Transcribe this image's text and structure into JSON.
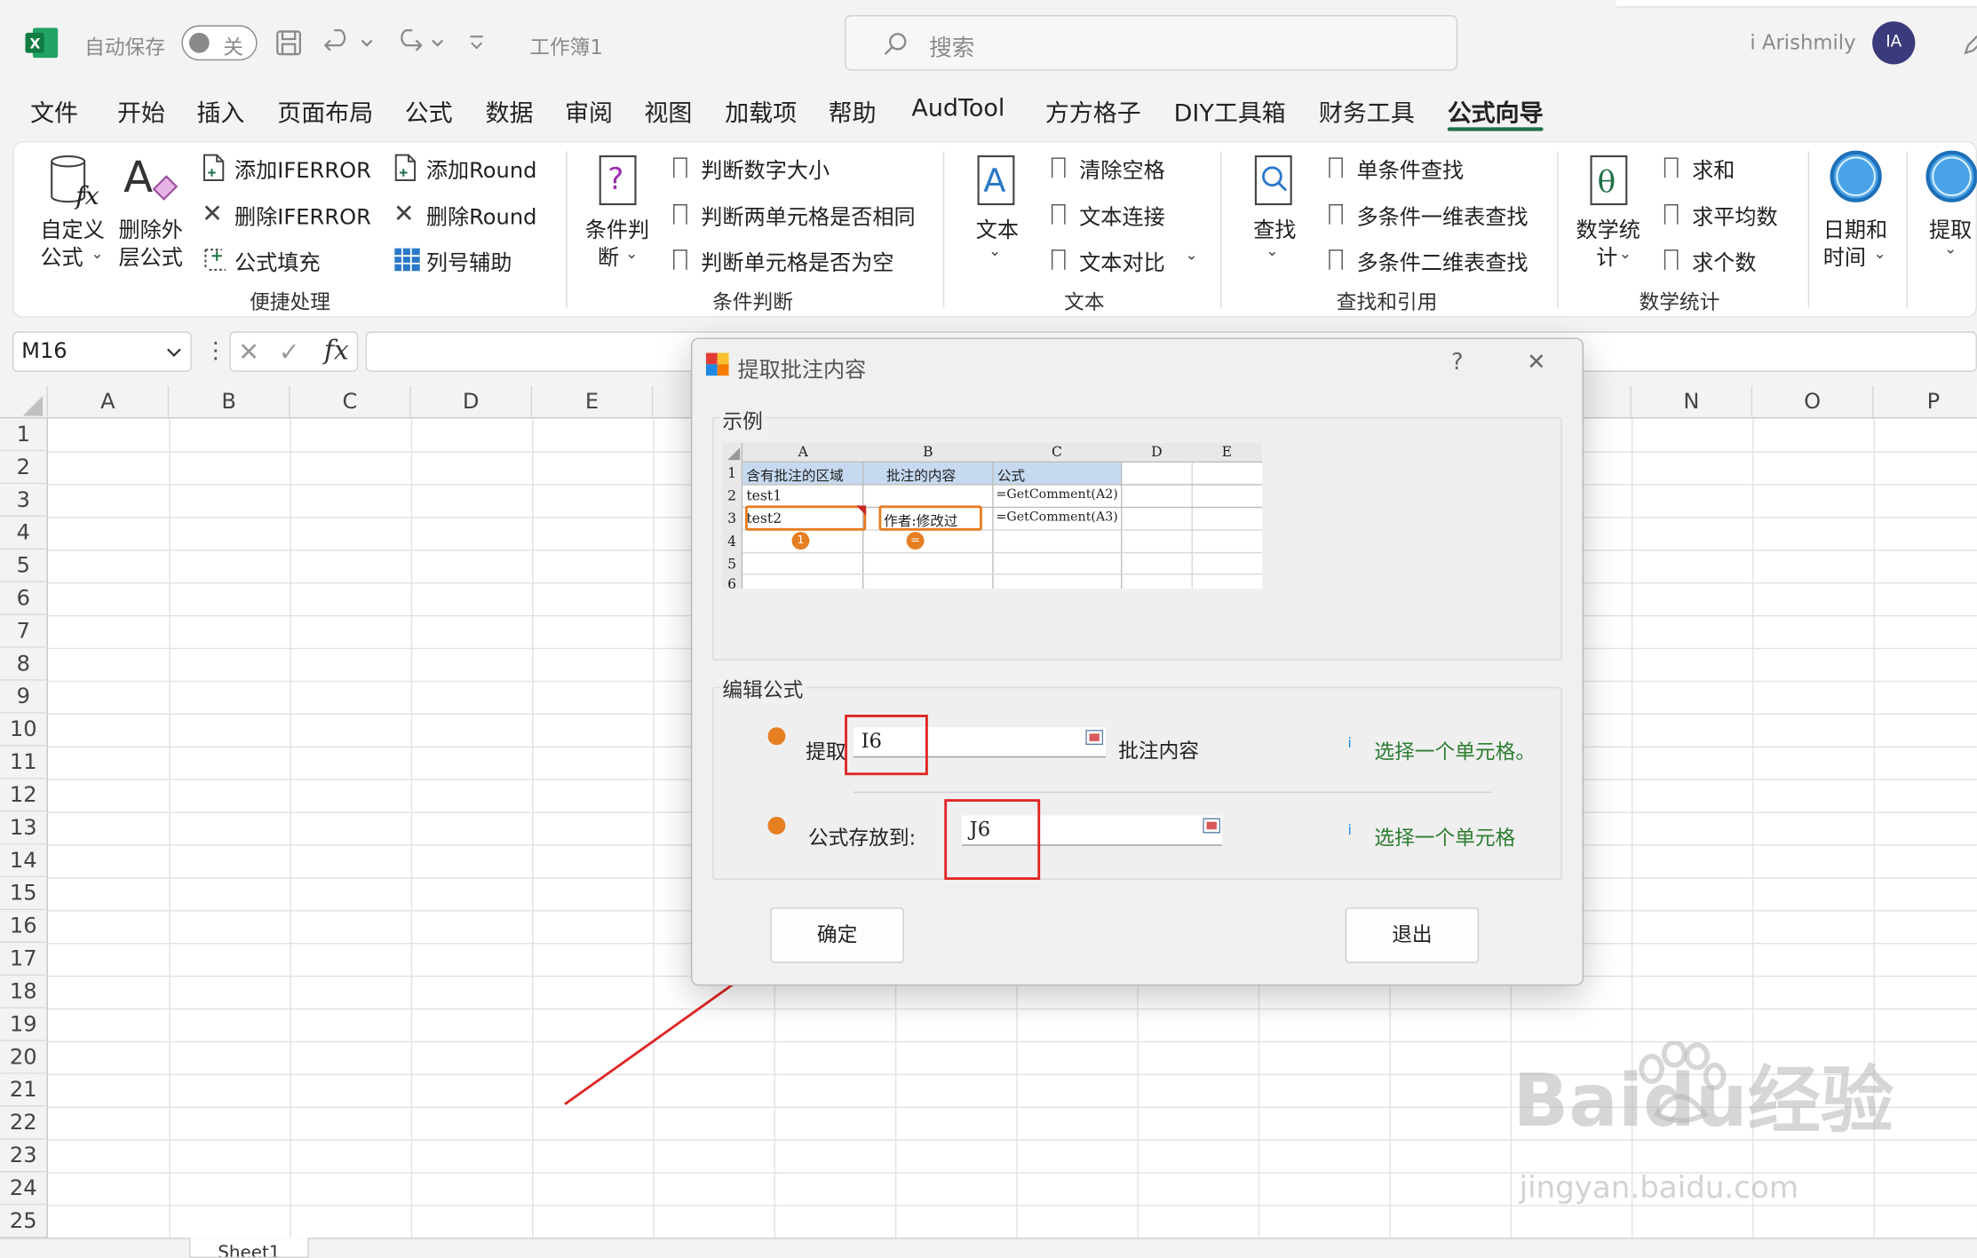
{
  "titlebar": {
    "autosave_label": "自动保存",
    "autosave_state": "关",
    "workbook_name": "工作簿1",
    "search_placeholder": "搜索",
    "user_name": "i Arishmily",
    "user_initials": "IA"
  },
  "menu_tabs": [
    "文件",
    "开始",
    "插入",
    "页面布局",
    "公式",
    "数据",
    "审阅",
    "视图",
    "加载项",
    "帮助",
    "AudTool",
    "方方格子",
    "DIY工具箱",
    "财务工具",
    "公式向导"
  ],
  "active_tab": "公式向导",
  "ribbon": {
    "convenient": {
      "label": "便捷处理",
      "custom_formula": [
        "自定义",
        "公式"
      ],
      "remove_outer": [
        "删除外",
        "层公式"
      ],
      "add_iferror": "添加IFERROR",
      "del_iferror": "删除IFERROR",
      "formula_fill": "公式填充",
      "add_round": "添加Round",
      "del_round": "删除Round",
      "col_helper": "列号辅助"
    },
    "condition": {
      "label": "条件判断",
      "cond_judge": [
        "条件判",
        "断"
      ],
      "judge_size": "判断数字大小",
      "judge_same": "判断两单元格是否相同",
      "judge_empty": "判断单元格是否为空"
    },
    "text": {
      "label": "文本",
      "text_btn": "文本",
      "clear_spaces": "清除空格",
      "text_concat": "文本连接",
      "text_compare": "文本对比"
    },
    "lookup": {
      "label": "查找和引用",
      "find": "查找",
      "single_lookup": "单条件查找",
      "multi_1d": "多条件一维表查找",
      "multi_2d": "多条件二维表查找"
    },
    "math": {
      "label": "数学统计",
      "math_stats": [
        "数学统",
        "计"
      ],
      "sum": "求和",
      "avg": "求平均数",
      "count": "求个数"
    },
    "datetime": [
      "日期和",
      "时间"
    ],
    "extract": "提取"
  },
  "formula_bar": {
    "name_box": "M16",
    "fx": "fx",
    "formula": ""
  },
  "grid": {
    "columns_left": [
      "A",
      "B",
      "C",
      "D",
      "E"
    ],
    "columns_right": [
      "N",
      "O",
      "P"
    ],
    "rows": [
      "1",
      "2",
      "3",
      "4",
      "5",
      "6",
      "7",
      "8",
      "9",
      "10",
      "11",
      "12",
      "13",
      "14",
      "15",
      "16",
      "17",
      "18",
      "19",
      "20",
      "21",
      "22",
      "23",
      "24",
      "25"
    ],
    "sheet_tab": "Sheet1"
  },
  "dialog": {
    "title": "提取批注内容",
    "help": "?",
    "close": "✕",
    "example_label": "示例",
    "example": {
      "col_headers": [
        "A",
        "B",
        "C",
        "D",
        "E"
      ],
      "row_headers": [
        "1",
        "2",
        "3",
        "4",
        "5",
        "6"
      ],
      "header_a": "含有批注的区域",
      "header_b": "批注的内容",
      "header_c": "公式",
      "a2": "test1",
      "a3": "test2",
      "b3": "作者:修改过",
      "c2": "=GetComment(A2)",
      "c3": "=GetComment(A3)",
      "marker1": "1",
      "marker2": "="
    },
    "edit_label": "编辑公式",
    "extract_label": "提取",
    "extract_value": "I6",
    "comment_content": "批注内容",
    "hint1": "选择一个单元格。",
    "store_label": "公式存放到:",
    "store_value": "J6",
    "hint2": "选择一个单元格",
    "ok": "确定",
    "exit": "退出"
  },
  "watermark": {
    "brand": "Baidu经验",
    "url": "jingyan.baidu.com"
  },
  "colors": {
    "excel_green": "#1e7145",
    "accent_orange": "#e67e22",
    "annotation_red": "#e02424",
    "hint_green": "#2e7d32"
  }
}
